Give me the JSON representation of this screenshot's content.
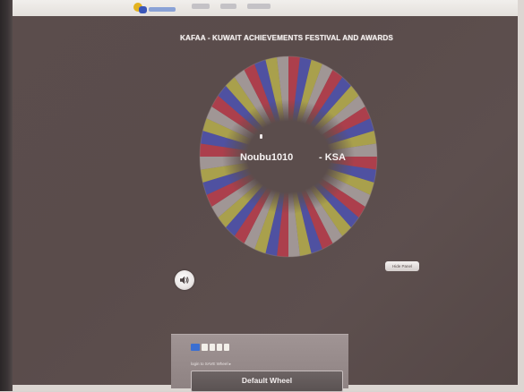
{
  "page": {
    "title": "KAFAA - KUWAIT ACHIEVEMENTS FESTIVAL AND AWARDS"
  },
  "wheel": {
    "winner_name": "Noubu1010",
    "winner_country": "- KSA",
    "segment_colors": [
      "#b73a4a",
      "#4a4fae",
      "#b4ac4a",
      "#a9a0a0"
    ]
  },
  "controls": {
    "sound_icon": "speaker-icon",
    "hide_button_label": "Hide Panel"
  },
  "panel": {
    "small_text": "login to SAVE Wheel ▸",
    "button_label": "Default Wheel"
  },
  "colors": {
    "background": "#5b4d4c",
    "title_text": "#f4efee",
    "red": "#b73a4a",
    "blue": "#4a4fae",
    "yellow": "#b4ac4a"
  }
}
